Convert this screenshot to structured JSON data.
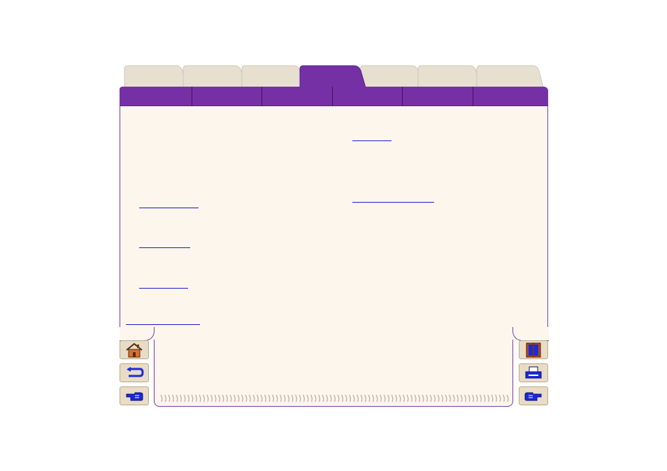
{
  "tabs": [
    {
      "label": ""
    },
    {
      "label": ""
    },
    {
      "label": ""
    },
    {
      "label": ""
    },
    {
      "label": ""
    },
    {
      "label": ""
    },
    {
      "label": ""
    }
  ],
  "band_segments": [
    {
      "label": ""
    },
    {
      "label": ""
    },
    {
      "label": ""
    },
    {
      "label": ""
    },
    {
      "label": ""
    },
    {
      "label": ""
    }
  ],
  "links": {
    "left_1": "",
    "left_2": "",
    "left_3": "",
    "left_4": "",
    "right_1": "",
    "right_2": ""
  },
  "nav": {
    "home": "home-icon",
    "back": "back-arrow-icon",
    "next_left": "pointing-hand-icon",
    "contents": "book-icon",
    "print": "printer-icon",
    "next_right": "pointing-hand-icon"
  },
  "colors": {
    "band": "#7530a6",
    "active_tab": "#7530a6",
    "inactive_tab": "#e7e0d1",
    "page": "#fcf6ec",
    "link": "#0000cc"
  }
}
